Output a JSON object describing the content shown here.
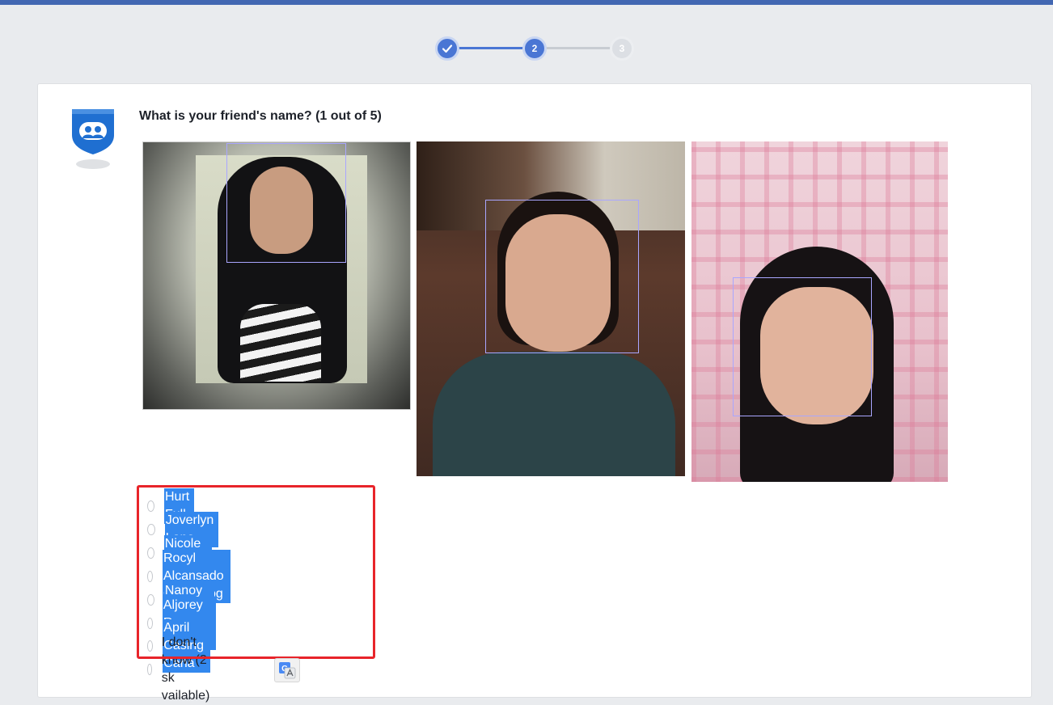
{
  "stepper": {
    "steps": [
      {
        "label": "",
        "state": "done"
      },
      {
        "label": "2",
        "state": "current"
      },
      {
        "label": "3",
        "state": "upcoming"
      }
    ]
  },
  "question": "What is your friend's name? (1 out of 5)",
  "options": [
    {
      "label": "Hurt Full",
      "highlighted": true
    },
    {
      "label": "Joverlyn Lano",
      "highlighted": true
    },
    {
      "label": "Nicole Galang",
      "highlighted": true
    },
    {
      "label": "Rocyl Alcansado Cadungog",
      "highlighted": true
    },
    {
      "label": "Nanoy Isabelle",
      "highlighted": true
    },
    {
      "label": "Aljorey Romo Lazarito",
      "highlighted": true
    },
    {
      "label": "April Casing Caña",
      "highlighted": true
    },
    {
      "label": "I don't know (2 sk",
      "label_tail": "vailable)",
      "highlighted": false
    }
  ],
  "colors": {
    "accent": "#4a76d4",
    "highlight": "#3388ee",
    "annotation": "#e8242a"
  },
  "icons": {
    "shield": "friends-shield-icon",
    "check": "check-icon",
    "translate": "google-translate-icon"
  }
}
